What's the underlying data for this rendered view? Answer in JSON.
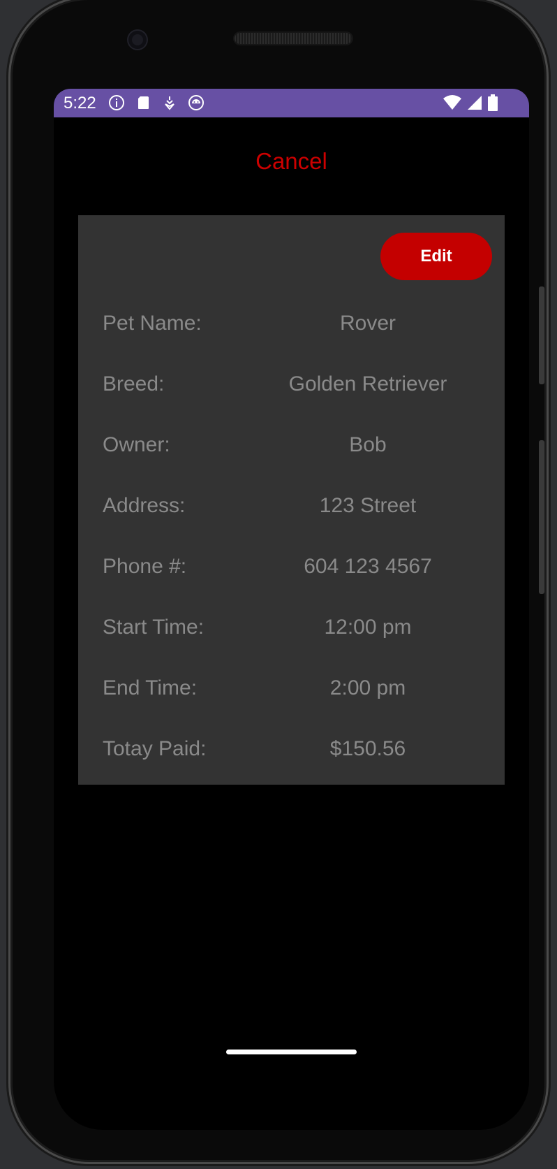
{
  "status_bar": {
    "time": "5:22",
    "color": "#6750a4",
    "left_icons": [
      "info-icon",
      "sd-card-icon",
      "debug-icon",
      "android-icon"
    ],
    "right_icons": [
      "wifi-icon",
      "signal-icon",
      "battery-icon"
    ]
  },
  "header": {
    "cancel_label": "Cancel",
    "cancel_color": "#cc0000"
  },
  "card": {
    "edit_label": "Edit",
    "edit_color": "#c40000",
    "rows": [
      {
        "label": "Pet Name:",
        "value": "Rover"
      },
      {
        "label": "Breed:",
        "value": "Golden Retriever"
      },
      {
        "label": "Owner:",
        "value": "Bob"
      },
      {
        "label": "Address:",
        "value": "123 Street"
      },
      {
        "label": "Phone #:",
        "value": "604 123 4567"
      },
      {
        "label": "Start Time:",
        "value": "12:00 pm"
      },
      {
        "label": "End Time:",
        "value": "2:00 pm"
      },
      {
        "label": "Totay Paid:",
        "value": "$150.56"
      }
    ]
  }
}
